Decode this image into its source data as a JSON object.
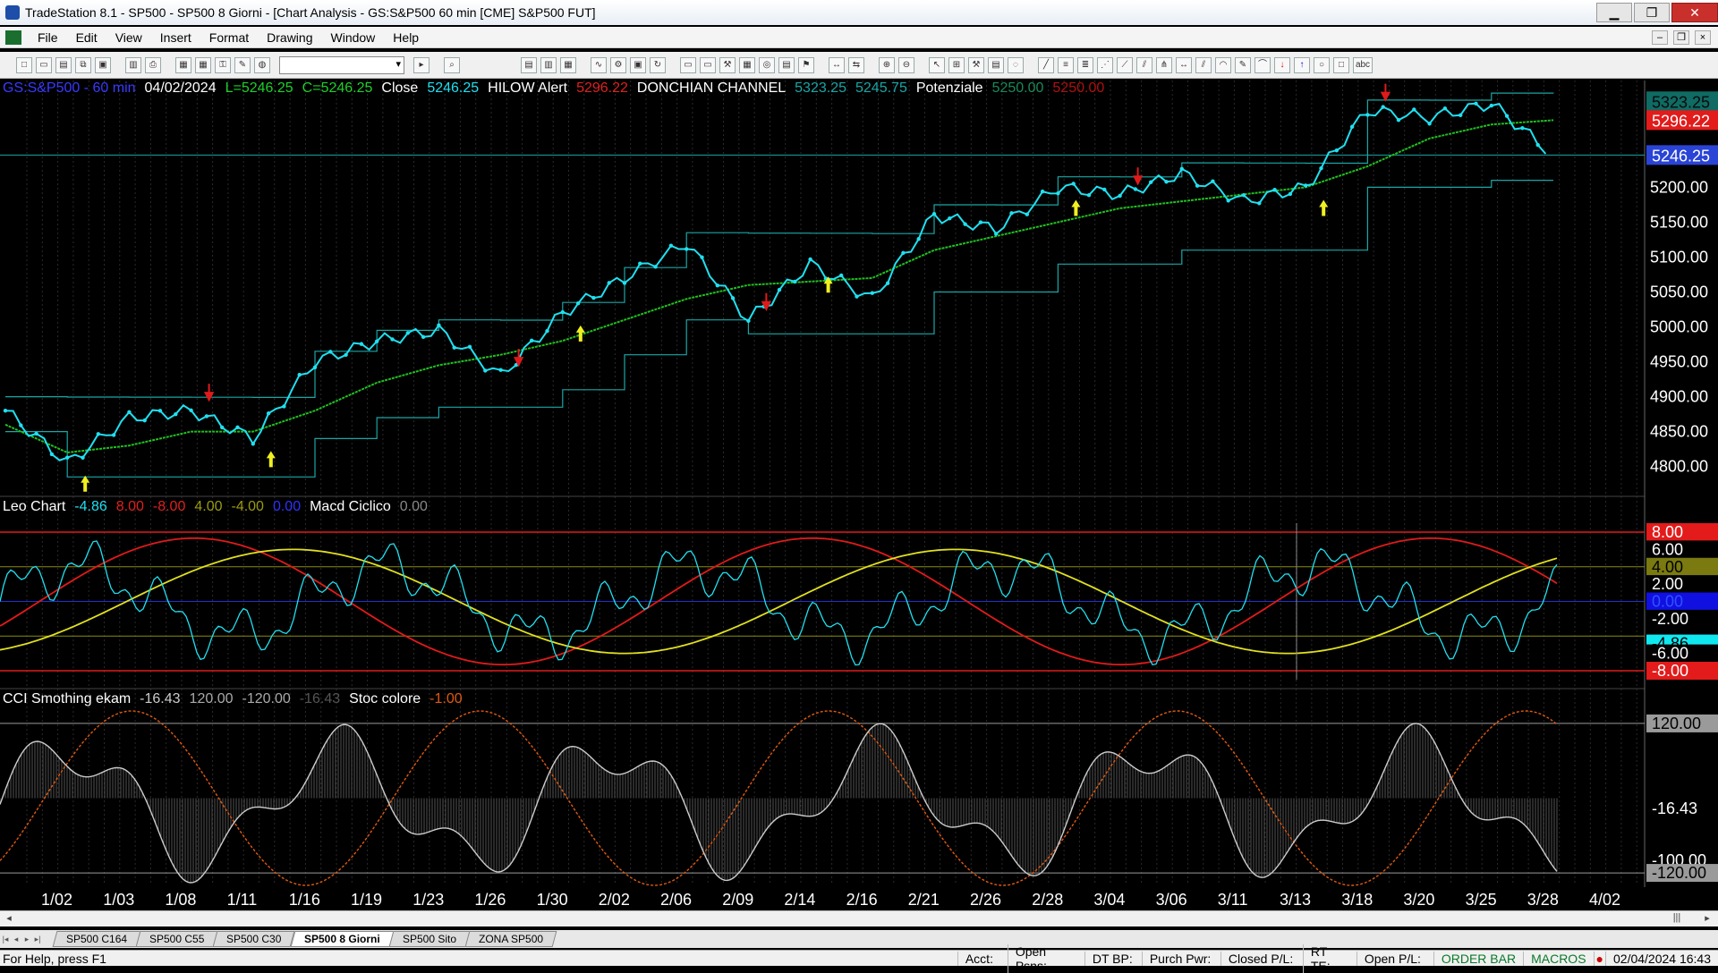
{
  "window": {
    "title": "TradeStation 8.1 - SP500 - SP500 8 Giorni - [Chart Analysis - GS:S&P500  60 min  [CME] S&P500 FUT]",
    "minimize": "▁",
    "restore": "❐",
    "close": "✕"
  },
  "menu": [
    "File",
    "Edit",
    "View",
    "Insert",
    "Format",
    "Drawing",
    "Window",
    "Help"
  ],
  "mdi_buttons": [
    "–",
    "❐",
    "×"
  ],
  "toolbar": {
    "symbol_value": ""
  },
  "legend_price": {
    "symbol": "GS:S&P500 - 60 min",
    "date": "04/02/2024",
    "low": "L=5246.25",
    "close": "C=5246.25",
    "close_label": "Close",
    "close_value": "5246.25",
    "hilow_label": "HILOW Alert",
    "hilow_value": "5296.22",
    "donchian_label": "DONCHIAN CHANNEL",
    "donchian_upper": "5323.25",
    "donchian_lower": "5245.75",
    "potenziale_label": "Potenziale",
    "potenziale_value1": "5250.00",
    "potenziale_value2": "5250.00"
  },
  "legend_osc": {
    "name": "Leo Chart",
    "v1": "-4.86",
    "v2": "8.00",
    "v3": "-8.00",
    "v4": "4.00",
    "v5": "-4.00",
    "v6": "0.00",
    "macd_label": "Macd Ciclico",
    "macd_value": "0.00"
  },
  "legend_cci": {
    "name": "CCI Smothing ekam",
    "v1": "-16.43",
    "v2": "120.00",
    "v3": "-120.00",
    "v4": "-16.43",
    "stoc_label": "Stoc colore",
    "stoc_value": "-1.00"
  },
  "price_axis": {
    "ticks": [
      "5200.00",
      "5150.00",
      "5100.00",
      "5050.00",
      "5000.00",
      "4950.00",
      "4900.00",
      "4850.00",
      "4800.00"
    ],
    "tags": [
      {
        "text": "5323.25",
        "bg": "#0f6b63",
        "fg": "#0a0a0a"
      },
      {
        "text": "5296.22",
        "bg": "#e31b1b",
        "fg": "#ffffff"
      },
      {
        "text": "5246.25",
        "bg": "#2a44d6",
        "fg": "#ffffff"
      }
    ]
  },
  "osc_axis": {
    "tags": [
      {
        "text": "8.00",
        "bg": "#e31b1b",
        "fg": "#ffffff"
      },
      {
        "text": "6.00",
        "bg": "#000000",
        "fg": "#ffffff"
      },
      {
        "text": "4.00",
        "bg": "#7a7a10",
        "fg": "#000000"
      },
      {
        "text": "2.00",
        "bg": "#000000",
        "fg": "#ffffff"
      },
      {
        "text": "0.00",
        "bg": "#1010e0",
        "fg": "#3050ff"
      },
      {
        "text": "-2.00",
        "bg": "#000000",
        "fg": "#ffffff"
      },
      {
        "text": "-4.86",
        "bg": "#10e8f0",
        "fg": "#000000"
      },
      {
        "text": "-6.00",
        "bg": "#000000",
        "fg": "#ffffff"
      },
      {
        "text": "-8.00",
        "bg": "#e31b1b",
        "fg": "#ffffff"
      }
    ]
  },
  "cci_axis": {
    "tags": [
      {
        "text": "120.00",
        "bg": "#9a9a9a",
        "fg": "#000000"
      },
      {
        "text": "-16.43",
        "bg": "#000000",
        "fg": "#ffffff"
      },
      {
        "text": "-100.00",
        "bg": "#000000",
        "fg": "#ffffff"
      },
      {
        "text": "-120.00",
        "bg": "#9a9a9a",
        "fg": "#000000"
      }
    ]
  },
  "date_axis": [
    "1/02",
    "1/03",
    "1/08",
    "1/11",
    "1/16",
    "1/19",
    "1/23",
    "1/26",
    "1/30",
    "2/02",
    "2/06",
    "2/09",
    "2/14",
    "2/16",
    "2/21",
    "2/26",
    "2/28",
    "3/04",
    "3/06",
    "3/11",
    "3/13",
    "3/18",
    "3/20",
    "3/25",
    "3/28",
    "4/02"
  ],
  "tabs": [
    "SP500 C164",
    "SP500 C55",
    "SP500 C30",
    "SP500 8 Giorni",
    "SP500 Sito",
    "ZONA SP500"
  ],
  "active_tab": "SP500 8 Giorni",
  "status": {
    "help": "For Help, press F1",
    "acct": "Acct:",
    "open_psns": "Open Psns:",
    "dt_bp": "DT BP:",
    "purch_pwr": "Purch Pwr:",
    "closed_pl": "Closed P/L:",
    "rt_te": "RT TE:",
    "open_pl": "Open P/L:",
    "order_bar": "ORDER BAR",
    "macros": "MACROS",
    "datetime": "02/04/2024 16:43"
  },
  "colors": {
    "price": "#20e0f0",
    "channel": "#1aa6a6",
    "avg_green": "#20c020",
    "avg_red": "#d02020",
    "osc_red": "#e01a1a",
    "osc_yellow": "#e0e020",
    "stoc": "#e05a10"
  },
  "chart_data": {
    "type": "line",
    "title": "GS:S&P500 - 60 min",
    "x": [
      "1/02",
      "1/03",
      "1/08",
      "1/11",
      "1/16",
      "1/19",
      "1/23",
      "1/26",
      "1/30",
      "2/02",
      "2/06",
      "2/09",
      "2/14",
      "2/16",
      "2/21",
      "2/26",
      "2/28",
      "3/04",
      "3/06",
      "3/11",
      "3/13",
      "3/18",
      "3/20",
      "3/25",
      "3/28",
      "4/02"
    ],
    "series": [
      {
        "name": "Close",
        "values": [
          4880,
          4805,
          4870,
          4880,
          4840,
          4950,
          4980,
          4995,
          4930,
          5020,
          5070,
          5120,
          5010,
          5090,
          5040,
          5160,
          5140,
          5200,
          5190,
          5220,
          5180,
          5200,
          5310,
          5300,
          5320,
          5246.25
        ]
      },
      {
        "name": "HILOW Alert",
        "values": [
          4860,
          4820,
          4830,
          4850,
          4850,
          4880,
          4920,
          4945,
          4960,
          4980,
          5010,
          5040,
          5060,
          5065,
          5070,
          5110,
          5130,
          5150,
          5170,
          5180,
          5190,
          5200,
          5230,
          5270,
          5290,
          5296.22
        ]
      }
    ],
    "ylim": [
      4770,
      5330
    ]
  }
}
